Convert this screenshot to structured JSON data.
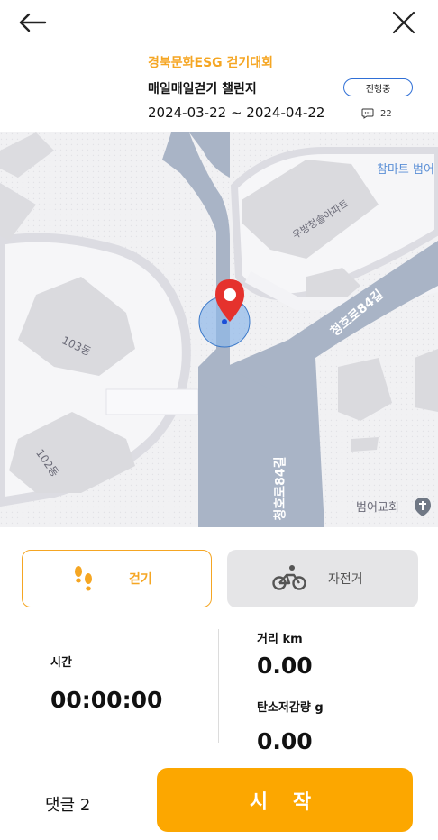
{
  "nav": {
    "back_icon": "arrow-left-icon",
    "close_icon": "close-icon"
  },
  "challenge": {
    "event_name": "경북문화ESG 걷기대회",
    "title": "매일매일걷기 챌린지",
    "status": "진행중",
    "date_range": "2024-03-22 ~ 2024-04-22",
    "comment_count": "22"
  },
  "map": {
    "labels": {
      "apartment": "우방청솔아파트",
      "building_103": "103동",
      "building_102": "102동",
      "road_1": "청호로84길",
      "road_2": "청호로84길",
      "store": "참마트 범어",
      "church": "범어교회"
    },
    "marker_icon": "location-pin-icon"
  },
  "modes": {
    "walk": {
      "label": "걷기",
      "icon": "footprints-icon",
      "selected": true
    },
    "bike": {
      "label": "자전거",
      "icon": "bicycle-icon",
      "selected": false
    }
  },
  "stats": {
    "time_label": "시간",
    "time_value": "00:00:00",
    "distance_label": "거리 km",
    "distance_value": "0.00",
    "carbon_label": "탄소저감량 g",
    "carbon_value": "0.00"
  },
  "footer": {
    "comments_label": "댓글 2",
    "start_label": "시 작"
  },
  "colors": {
    "accent": "#f5a623",
    "start_button": "#fca700",
    "status_border": "#2f6fd6",
    "road": "#a9b4c6"
  }
}
